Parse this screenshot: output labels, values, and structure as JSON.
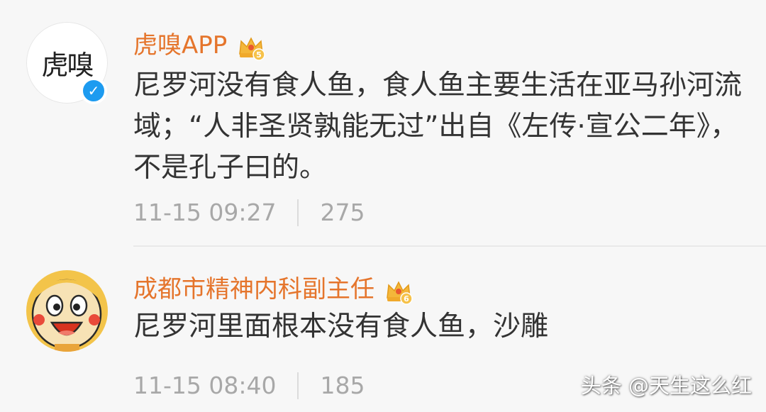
{
  "comments": [
    {
      "username": "虎嗅APP",
      "avatar_text": "虎嗅",
      "level": "5",
      "verified": true,
      "content": "尼罗河没有食人鱼，食人鱼主要生活在亚马孙河流域；“人非圣贤孰能无过”出自《左传·宣公二年》，不是孔子曰的。",
      "time": "11-15 09:27",
      "likes": "275"
    },
    {
      "username": "成都市精神内科副主任",
      "level": "6",
      "content": "尼罗河里面根本没有食人鱼，沙雕",
      "time": "11-15 08:40",
      "likes": "185"
    }
  ],
  "watermark": "头条 @天生这么红",
  "colors": {
    "username": "#e5752c",
    "meta": "#a8a8a8",
    "text": "#333333",
    "verified": "#1d9bf0"
  }
}
